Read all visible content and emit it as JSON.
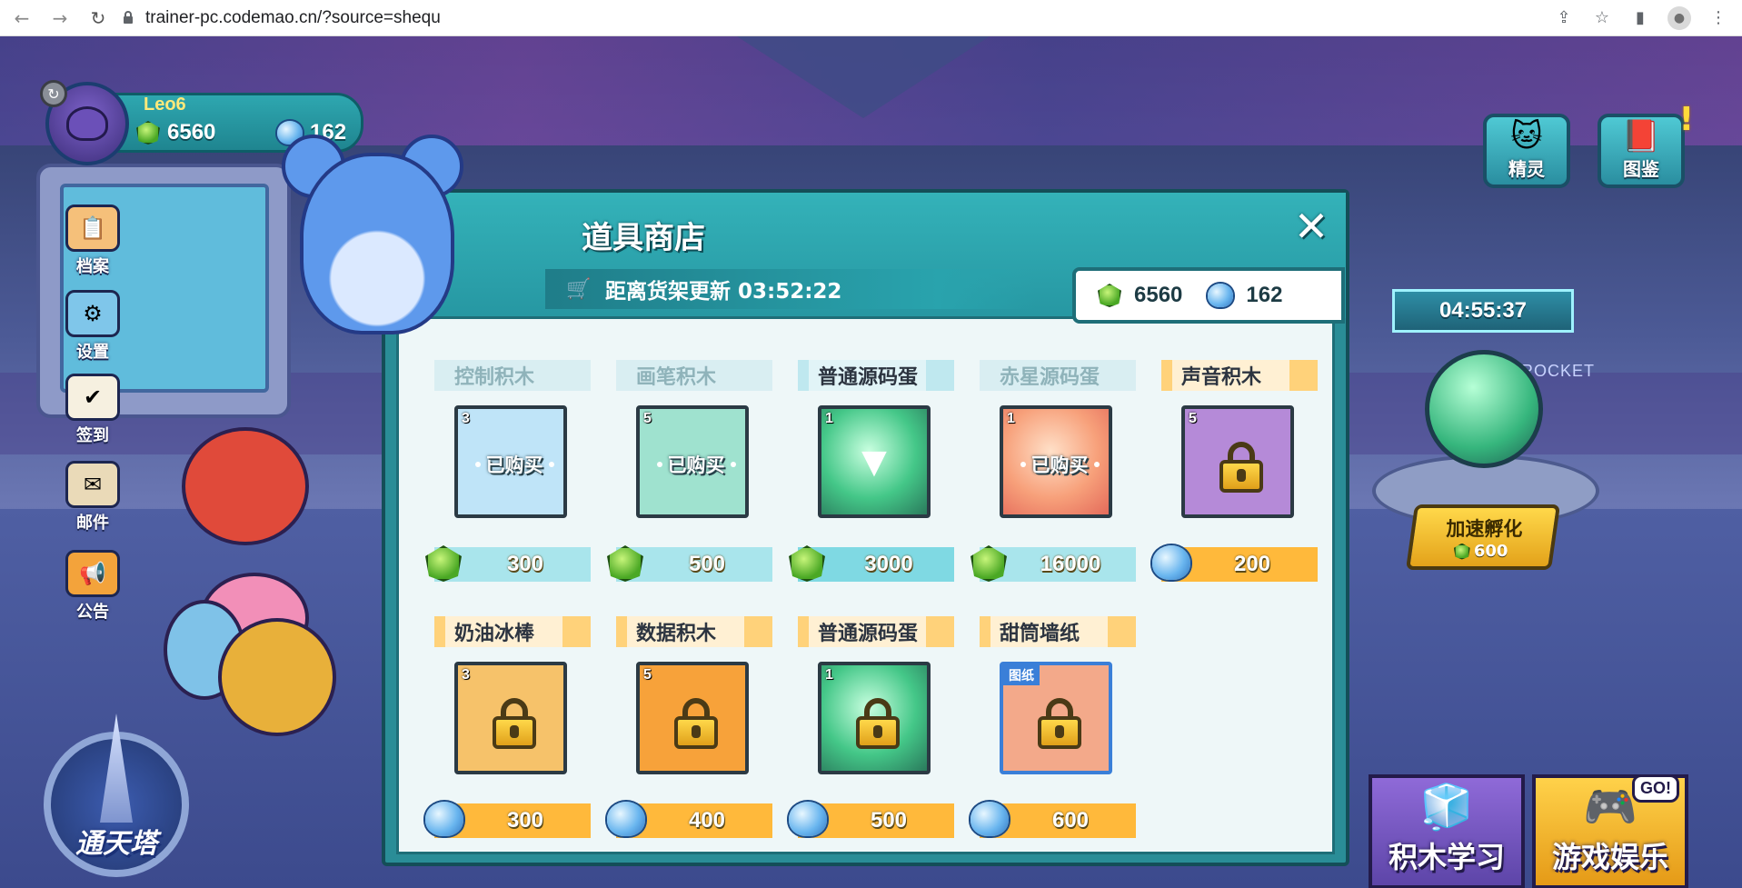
{
  "browser": {
    "url": "trainer-pc.codemao.cn/?source=shequ",
    "back_icon": "arrow-left-icon",
    "forward_icon": "arrow-right-icon",
    "reload_icon": "reload-icon",
    "lock_icon": "lock-icon",
    "share_icon": "share-icon",
    "star_icon": "star-icon",
    "sidepanel_icon": "sidepanel-icon",
    "profile_icon": "profile-icon",
    "menu_icon": "kebab-menu-icon"
  },
  "profile": {
    "name": "Leo6",
    "gems": "6560",
    "crystals": "162"
  },
  "left_menu": [
    {
      "label": "档案",
      "icon": "file-icon"
    },
    {
      "label": "设置",
      "icon": "settings-icon"
    },
    {
      "label": "签到",
      "icon": "calendar-check-icon"
    },
    {
      "label": "邮件",
      "icon": "mail-icon"
    },
    {
      "label": "公告",
      "icon": "megaphone-icon"
    }
  ],
  "tower_label": "通天塔",
  "right_top": {
    "sprite_label": "精灵",
    "codex_label": "图鉴",
    "alert": "!"
  },
  "incubator": {
    "timer": "04:55:37",
    "rocket_text": "AO ROCKET",
    "hatch_label": "加速孵化",
    "hatch_cost": "600"
  },
  "bottom_buttons": {
    "learn_label": "积木学习",
    "play_label": "游戏娱乐",
    "go_badge": "GO!"
  },
  "shop": {
    "title": "道具商店",
    "refresh_text": "距离货架更新 03:52:22",
    "close_icon": "close-icon",
    "cart_icon": "cart-icon",
    "balance_gems": "6560",
    "balance_crystals": "162",
    "bought_label": "已购买",
    "items": [
      {
        "name": "控制积木",
        "qty": "3",
        "price": "300",
        "currency": "gem",
        "state": "bought"
      },
      {
        "name": "画笔积木",
        "qty": "5",
        "price": "500",
        "currency": "gem",
        "state": "bought"
      },
      {
        "name": "普通源码蛋",
        "qty": "1",
        "price": "3000",
        "currency": "gem",
        "state": "available"
      },
      {
        "name": "赤星源码蛋",
        "qty": "1",
        "price": "16000",
        "currency": "gem",
        "state": "bought"
      },
      {
        "name": "声音积木",
        "qty": "5",
        "price": "200",
        "currency": "crystal",
        "state": "locked"
      },
      {
        "name": "奶油冰棒",
        "qty": "3",
        "price": "300",
        "currency": "crystal",
        "state": "locked"
      },
      {
        "name": "数据积木",
        "qty": "5",
        "price": "400",
        "currency": "crystal",
        "state": "locked"
      },
      {
        "name": "普通源码蛋",
        "qty": "1",
        "price": "500",
        "currency": "crystal",
        "state": "locked"
      },
      {
        "name": "甜筒墙纸",
        "qty": "",
        "tag": "图纸",
        "price": "600",
        "currency": "crystal",
        "state": "locked"
      }
    ]
  }
}
